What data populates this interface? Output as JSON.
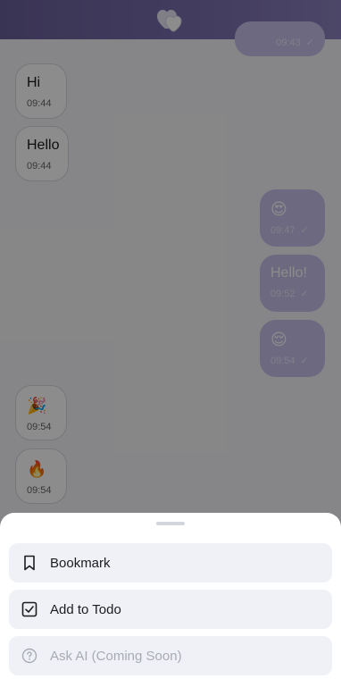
{
  "header": {
    "logo_icon": "hearts-logo-icon",
    "accent": "#6a5f9a"
  },
  "messages": [
    {
      "dir": "out",
      "text": "",
      "time": "09:43",
      "read": true
    },
    {
      "dir": "in",
      "text": "Hi",
      "time": "09:44"
    },
    {
      "dir": "in",
      "text": "Hello",
      "time": "09:44"
    },
    {
      "dir": "out",
      "text": "😍",
      "time": "09:47",
      "read": true
    },
    {
      "dir": "out",
      "text": "Hello!",
      "time": "09:52",
      "read": true
    },
    {
      "dir": "out",
      "text": "😌",
      "time": "09:54",
      "read": true
    },
    {
      "dir": "in",
      "text": "🎉",
      "time": "09:54"
    },
    {
      "dir": "in",
      "text": "🔥",
      "time": "09:54"
    }
  ],
  "sheet": {
    "actions": [
      {
        "label": "Bookmark",
        "icon": "bookmark-icon",
        "enabled": true
      },
      {
        "label": "Add to Todo",
        "icon": "checkbox-icon",
        "enabled": true
      },
      {
        "label": "Ask AI (Coming Soon)",
        "icon": "question-circle-icon",
        "enabled": false
      }
    ]
  }
}
